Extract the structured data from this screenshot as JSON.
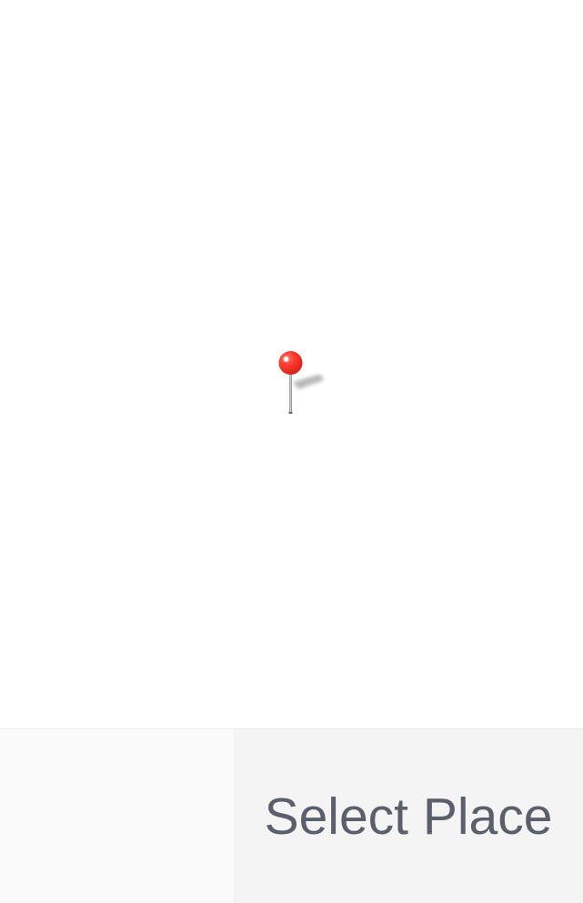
{
  "map": {
    "pin_icon": "map-pin-icon",
    "pin_color": "#ff3b30",
    "background_color": "#ffffff"
  },
  "bottom_bar": {
    "select_label": "Select Place",
    "label_color": "#5a5f6b",
    "button_background": "#f4f4f4"
  }
}
